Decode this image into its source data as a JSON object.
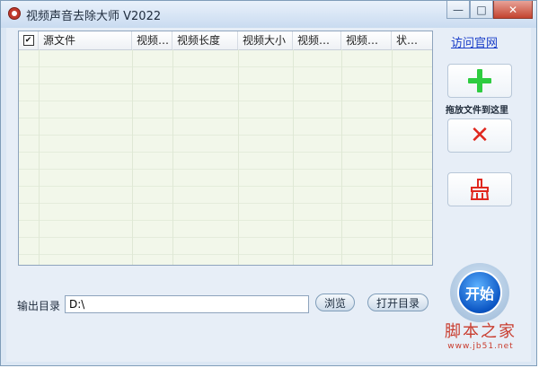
{
  "window": {
    "title": "视频声音去除大师 V2022",
    "minimize": "—",
    "maximize": "□",
    "close": "✕"
  },
  "list": {
    "header_check": "✔",
    "columns": [
      "源文件",
      "视频…",
      "视频长度",
      "视频大小",
      "视频…",
      "视频…",
      "状…"
    ]
  },
  "sidebar": {
    "visit_link": "访问官网",
    "drop_hint": "拖放文件到这里",
    "add_icon": "plus-icon",
    "delete_icon": "red-x-icon",
    "clear_icon": "broom-icon"
  },
  "output": {
    "label": "输出目录",
    "value": "D:\\",
    "browse_label": "浏览",
    "open_label": "打开目录"
  },
  "start": {
    "label": "开始"
  },
  "watermark": {
    "text": "脚本之家",
    "url": "www.jb51.net"
  },
  "colors": {
    "list_bg": "#f2f7ea",
    "accent": "#0c56c4",
    "close": "#c3432f"
  }
}
